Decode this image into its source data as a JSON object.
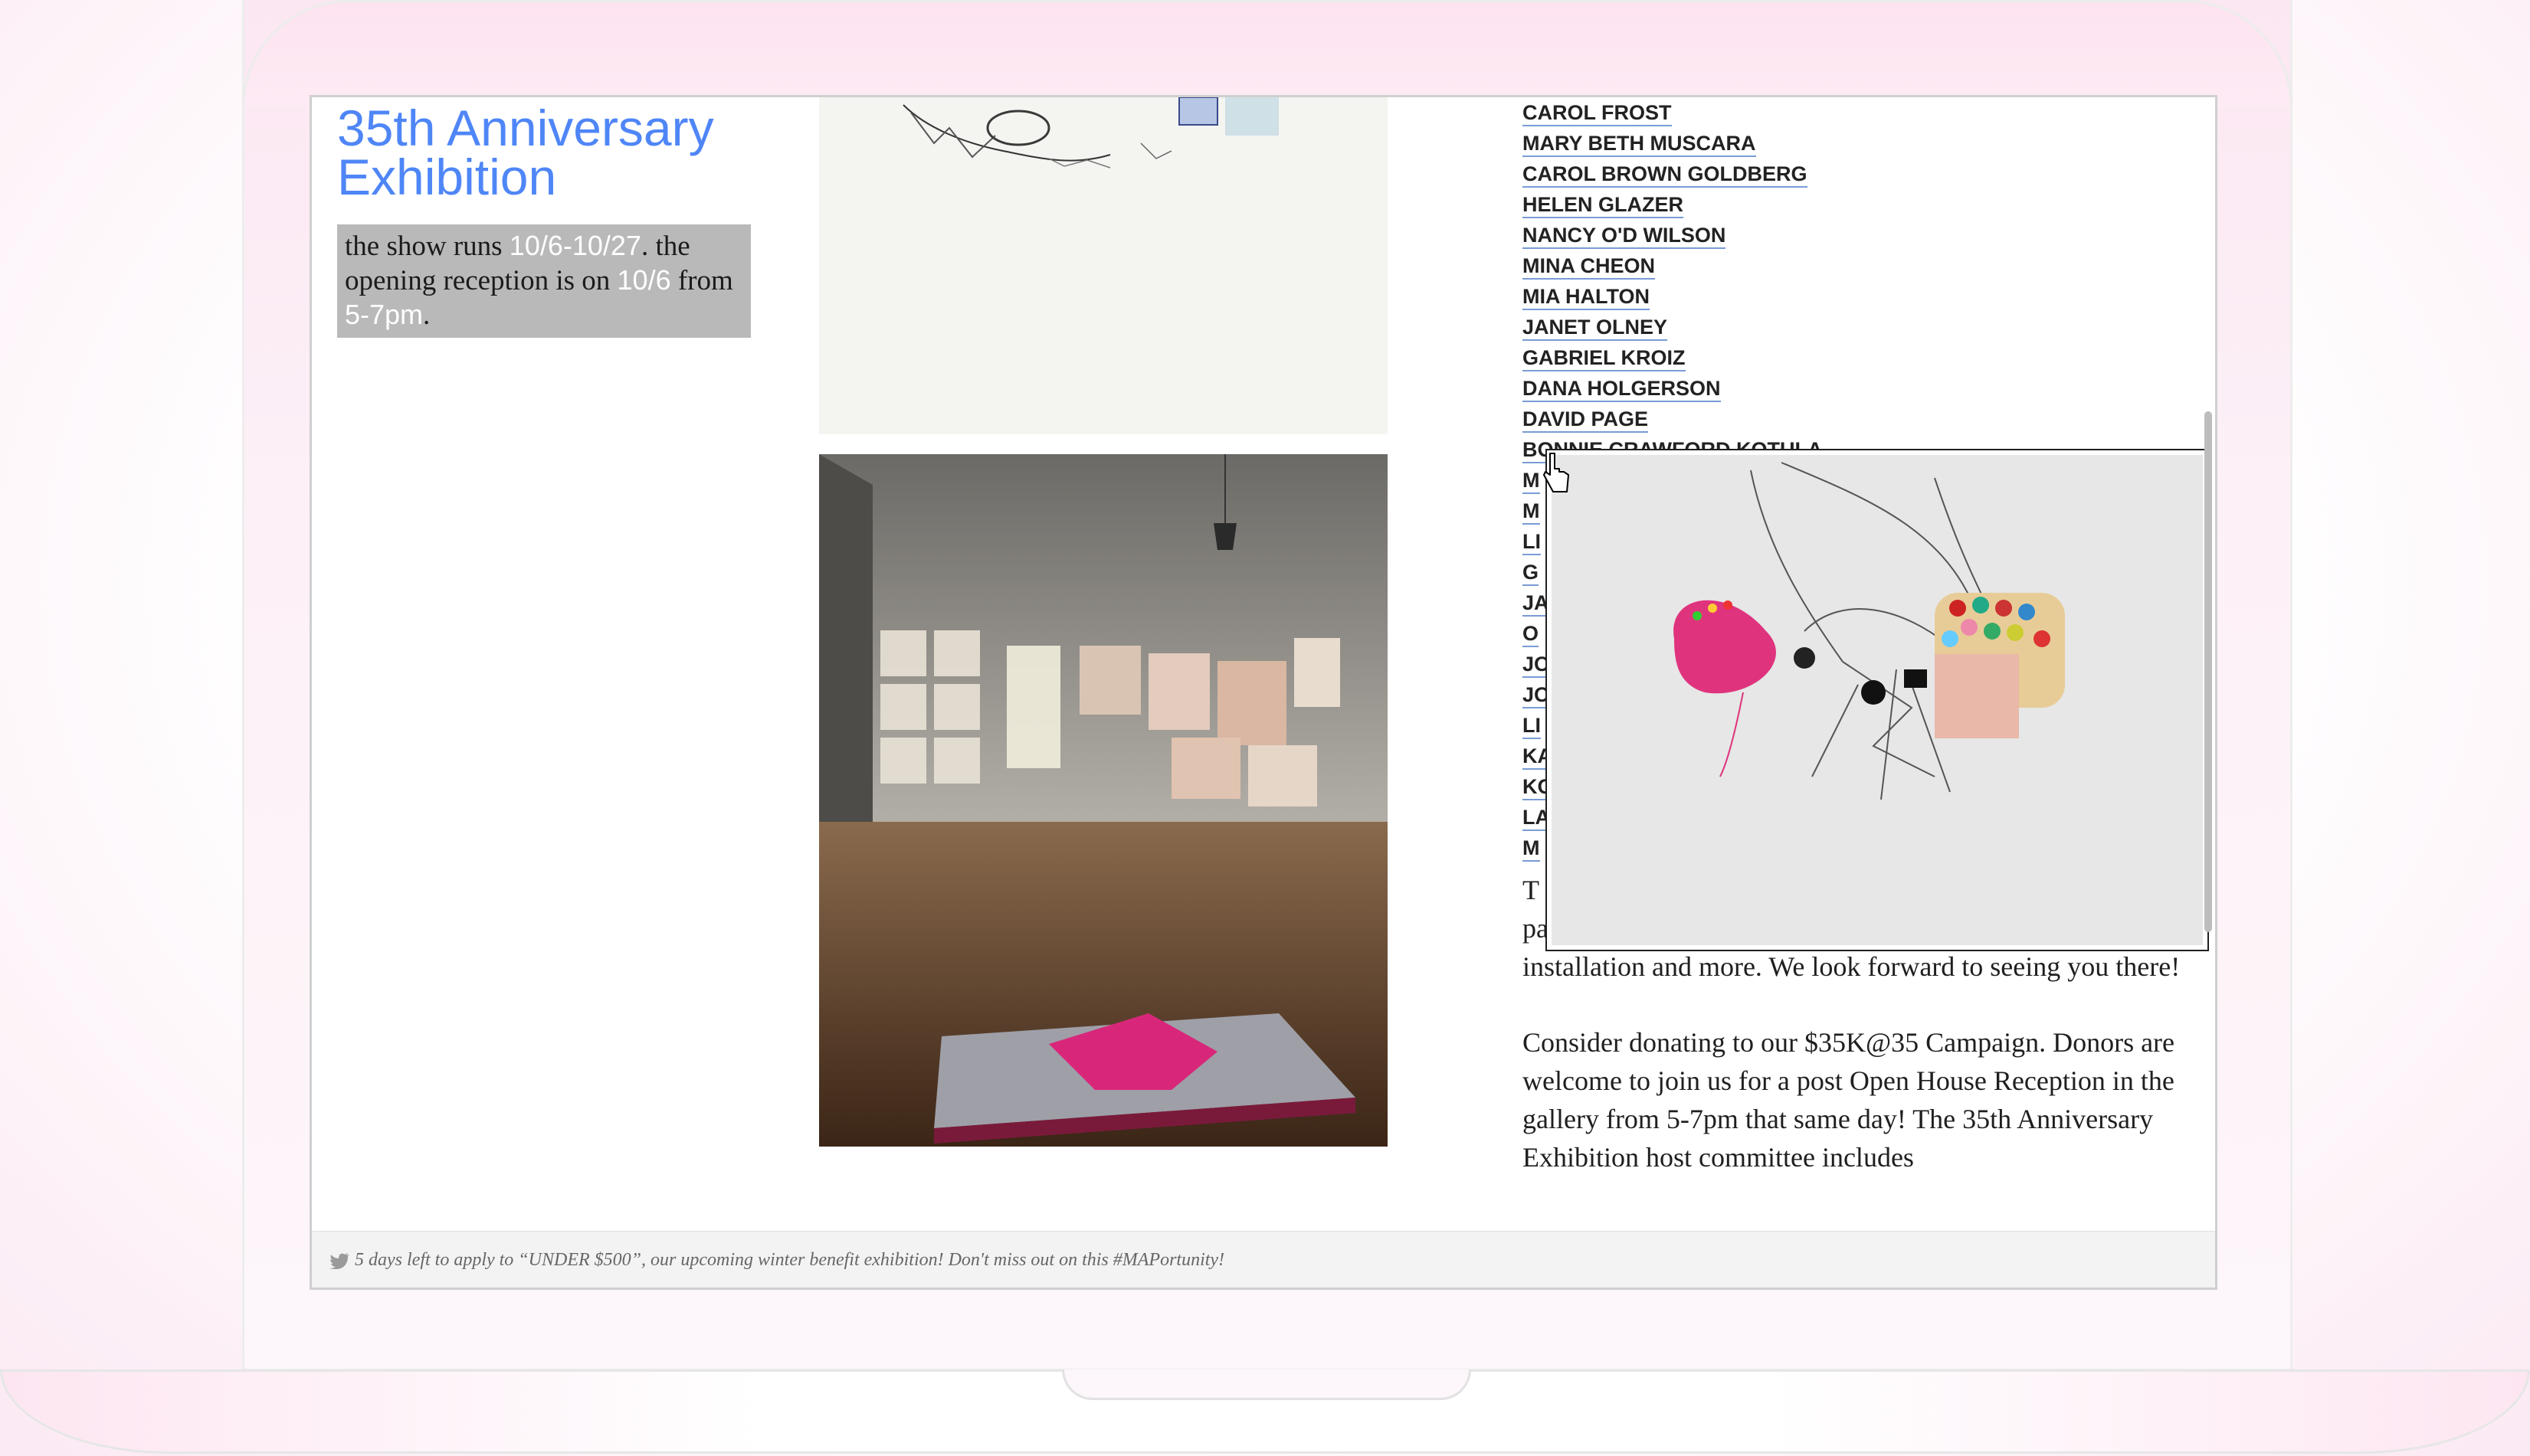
{
  "page": {
    "title": "35th Anniversary Exhibition",
    "show_info": {
      "part1": "the show runs ",
      "dates": "10/6-10/27",
      "part2": ". the opening reception is on ",
      "reception_date": "10/6",
      "part3": " from ",
      "reception_time": "5-7pm",
      "part4": "."
    }
  },
  "artists": [
    {
      "label": "CAROL FROST"
    },
    {
      "label": "MARY BETH MUSCARA"
    },
    {
      "label": "CAROL BROWN GOLDBERG"
    },
    {
      "label": "HELEN GLAZER"
    },
    {
      "label": "NANCY O'D WILSON"
    },
    {
      "label": "MINA CHEON"
    },
    {
      "label": "MIA HALTON"
    },
    {
      "label": "JANET OLNEY"
    },
    {
      "label": "GABRIEL KROIZ"
    },
    {
      "label": "DANA HOLGERSON"
    },
    {
      "label": "DAVID PAGE"
    },
    {
      "label": "BONNIE CRAWFORD KOTULA"
    },
    {
      "label": "M"
    },
    {
      "label": "M"
    },
    {
      "label": "LI"
    },
    {
      "label": "G"
    },
    {
      "label": "JA"
    },
    {
      "label": "O"
    },
    {
      "label": "JO"
    },
    {
      "label": "JO"
    },
    {
      "label": "LI"
    },
    {
      "label": "KA"
    },
    {
      "label": "KO"
    },
    {
      "label": "LA"
    },
    {
      "label": "M"
    }
  ],
  "body": {
    "p1_start": "T",
    "p1_line2": "pa",
    "p1_line3": "installation and more. We look forward to seeing you there!",
    "p2": "Consider donating to our $35K@35 Campaign. Donors are welcome to join us for a post Open House Reception in the gallery from 5-7pm that same day! The 35th Anniversary Exhibition host committee includes"
  },
  "footer": {
    "tweet": "5 days left to apply to “UNDER $500”, our upcoming winter benefit exhibition! Don't miss out on this #MAPortunity!"
  },
  "icons": {
    "twitter": "twitter-bird-icon",
    "cursor": "hand-pointer-icon"
  },
  "colors": {
    "accent": "#4f86f7",
    "show_box": "#b9b9b9",
    "link_underline": "#7a9bd6"
  }
}
